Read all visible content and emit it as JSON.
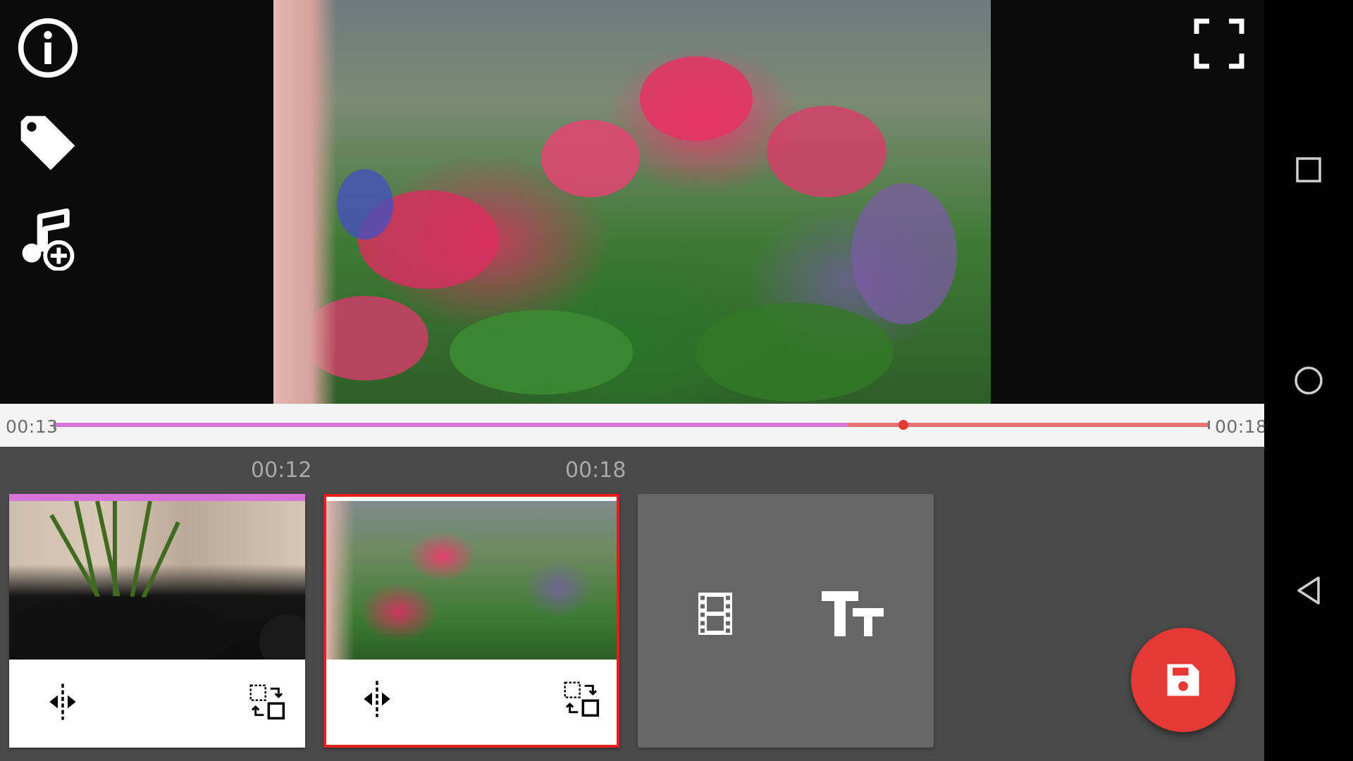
{
  "toolbar": {
    "info_icon": "info-icon",
    "tag_icon": "tag-icon",
    "add_music_icon": "music-add-icon",
    "fullscreen_icon": "fullscreen-icon"
  },
  "scrubber": {
    "start_time": "00:13",
    "end_time": "00:18",
    "played_fraction": 0.687,
    "playhead_fraction": 0.736,
    "colors": {
      "played": "#d874d8",
      "remaining": "#e67373",
      "playhead": "#e53935"
    }
  },
  "timeline": {
    "clips": [
      {
        "end_time": "00:12",
        "selected": false
      },
      {
        "end_time": "00:18",
        "selected": true
      }
    ],
    "add_video_icon": "film-icon",
    "add_text_icon": "text-size-icon"
  },
  "fab": {
    "icon": "save-icon",
    "color": "#e53935"
  },
  "navbar": {
    "recents_icon": "square-icon",
    "home_icon": "circle-icon",
    "back_icon": "triangle-back-icon"
  }
}
